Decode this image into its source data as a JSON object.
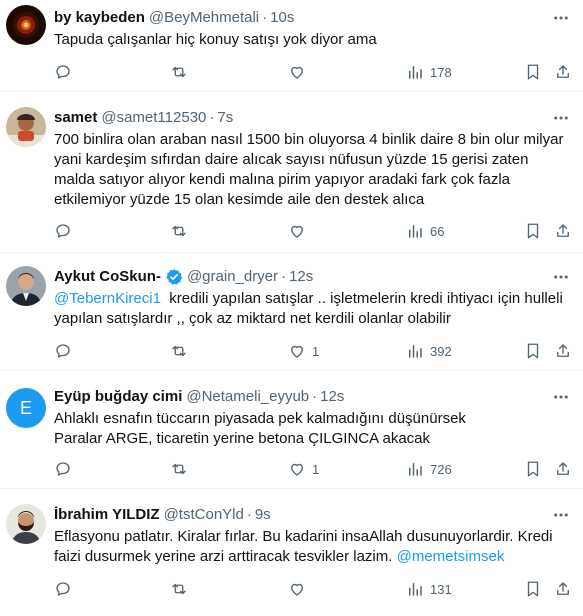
{
  "tweets": [
    {
      "name": "by kaybeden",
      "handle": "@BeyMehmetali",
      "time": "10s",
      "text": "Tapuda çalışanlar hiç konuy satışı yok diyor ama",
      "reply_count": "",
      "retweet_count": "",
      "like_count": "",
      "view_count": "178",
      "avatar_icon": "dark-fire-avatar"
    },
    {
      "name": "samet",
      "handle": "@samet112530",
      "time": "7s",
      "text": "700 binlira olan araban nasıl 1500 bin oluyorsa 4 binlik daire 8 bin olur milyar yani kardeşim sıfırdan daire alıcak sayısı nüfusun yüzde 15 gerisi zaten malda satıyor alıyor kendi malına pirim yapıyor aradaki fark çok fazla etkilemiyor yüzde 15 olan kesimde aile den destek alıca",
      "reply_count": "",
      "retweet_count": "",
      "like_count": "",
      "view_count": "66",
      "avatar_icon": "person-photo-avatar"
    },
    {
      "name": "Aykut CoSkun-",
      "handle": "@grain_dryer",
      "time": "12s",
      "verified": true,
      "mention": "@TebernKireci1",
      "text": "  kredili yapılan satışlar .. işletmelerin kredi ihtiyacı için hulleli yapılan satışlardır ,, çok az miktard net kerdili olanlar olabilir",
      "reply_count": "",
      "retweet_count": "",
      "like_count": "1",
      "view_count": "392",
      "avatar_icon": "person-suit-avatar"
    },
    {
      "name": "Eyüp buğday cimi",
      "handle": "@Netameli_eyyub",
      "time": "12s",
      "avatar_letter": "E",
      "text": "Ahlaklı esnafın tüccarın piyasada pek kalmadığını düşünürsek\nParalar ARGE, ticaretin yerine betona ÇILGINCA akacak",
      "reply_count": "",
      "retweet_count": "",
      "like_count": "1",
      "view_count": "726",
      "avatar_icon": "letter-avatar"
    },
    {
      "name": "İbrahim YILDIZ",
      "handle": "@tstConYld",
      "time": "9s",
      "text": "Eflasyonu patlatır. Kiralar fırlar. Bu kadarini insaAllah dusunuyorlardir. Kredi faizi dusurmek yerine arzi arttiracak tesvikler lazim. ",
      "mention": "@memetsimsek",
      "reply_count": "",
      "retweet_count": "",
      "like_count": "",
      "view_count": "131",
      "avatar_icon": "bearded-man-avatar"
    }
  ],
  "colors": {
    "text": "#0f1419",
    "secondary": "#536471",
    "link": "#1d9bf0",
    "divider": "#eff3f4",
    "letter_avatar_bg": "#1d9bf0"
  },
  "dot": "·"
}
